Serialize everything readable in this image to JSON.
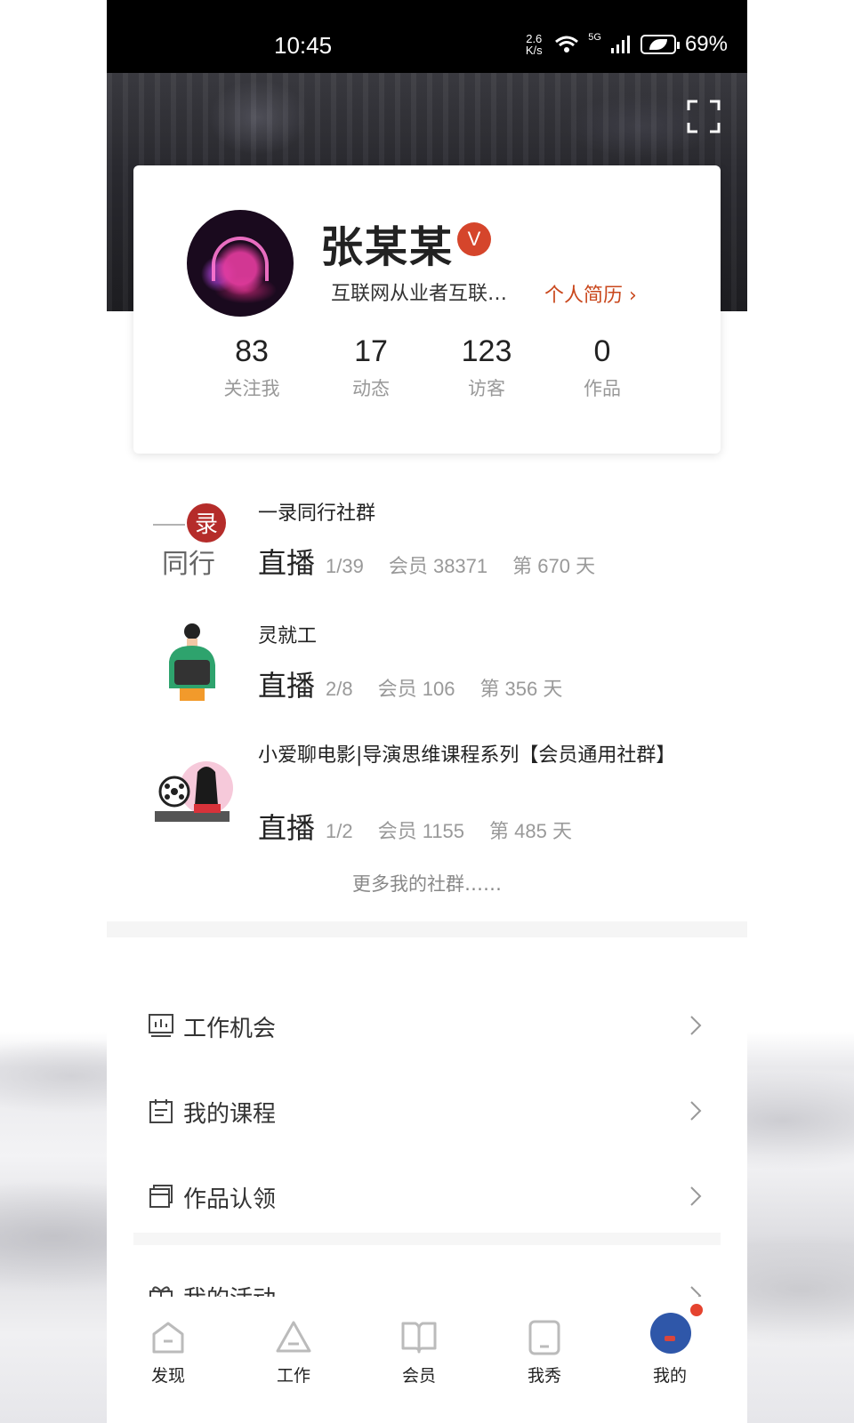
{
  "status_bar": {
    "time": "10:45",
    "net_speed_value": "2.6",
    "net_speed_unit": "K/s",
    "network_type": "5G",
    "battery": "69%"
  },
  "profile": {
    "name": "张某某",
    "verified_badge": "V",
    "bio": "互联网从业者互联…",
    "resume_link": "个人简历 ›",
    "stats": [
      {
        "value": "83",
        "label": "关注我"
      },
      {
        "value": "17",
        "label": "动态"
      },
      {
        "value": "123",
        "label": "访客"
      },
      {
        "value": "0",
        "label": "作品"
      }
    ]
  },
  "groups": [
    {
      "title": "一录同行社群",
      "live_label": "直播",
      "live": "1/39",
      "members": "会员 38371",
      "days": "第 670 天",
      "logo_text_top": "录",
      "logo_text_bottom": "同行"
    },
    {
      "title": "灵就工",
      "live_label": "直播",
      "live": "2/8",
      "members": "会员 106",
      "days": "第 356 天"
    },
    {
      "title": "小爱聊电影|导演思维课程系列【会员通用社群】",
      "live_label": "直播",
      "live": "1/2",
      "members": "会员 1155",
      "days": "第 485 天"
    }
  ],
  "more_groups": "更多我的社群……",
  "menu": [
    {
      "label": "工作机会",
      "icon": "chart-board-icon"
    },
    {
      "label": "我的课程",
      "icon": "calendar-icon"
    },
    {
      "label": "作品认领",
      "icon": "cards-icon"
    },
    {
      "label": "我的活动",
      "icon": "gift-icon"
    }
  ],
  "tabs": [
    {
      "label": "发现",
      "icon": "home-icon"
    },
    {
      "label": "工作",
      "icon": "triangle-icon"
    },
    {
      "label": "会员",
      "icon": "book-icon"
    },
    {
      "label": "我秀",
      "icon": "phone-icon"
    },
    {
      "label": "我的",
      "icon": "avatar-icon"
    }
  ],
  "colors": {
    "accent": "#c9471c",
    "badge": "#d5452b",
    "me_avatar": "#2f57a9",
    "notify_dot": "#e5432f"
  }
}
